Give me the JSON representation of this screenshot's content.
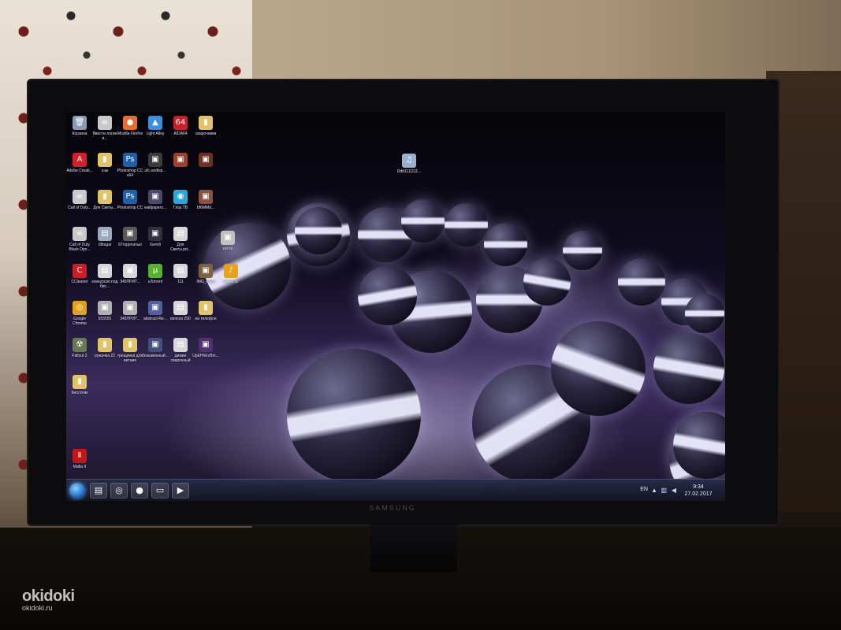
{
  "monitor": {
    "brand": "SAMSUNG"
  },
  "desktop": {
    "icons": [
      {
        "label": "Корзина",
        "icon": "recycle-bin-icon",
        "color": "#8a9bb8",
        "glyph": "🗑"
      },
      {
        "label": "Ввести логин и...",
        "icon": "skull-icon",
        "color": "#c9c9c9",
        "glyph": "☠"
      },
      {
        "label": "Mozilla Firefox",
        "icon": "firefox-icon",
        "color": "#e8702a",
        "glyph": "●"
      },
      {
        "label": "Light Alloy",
        "icon": "light-alloy-icon",
        "color": "#3b8fe0",
        "glyph": "▲"
      },
      {
        "label": "AIDA64",
        "icon": "aida64-icon",
        "color": "#c8202a",
        "glyph": "64"
      },
      {
        "label": "сварочники",
        "icon": "folder-icon",
        "color": "#e2c36a",
        "glyph": "▮"
      },
      {
        "label": "Adobe Creati...",
        "icon": "adobe-icon",
        "color": "#d4202a",
        "glyph": "A"
      },
      {
        "label": "ээы",
        "icon": "folder-icon",
        "color": "#e2c36a",
        "glyph": "▮"
      },
      {
        "label": "Photoshop CC x64",
        "icon": "photoshop-icon",
        "color": "#1f5fa8",
        "glyph": "Ps"
      },
      {
        "label": "ufc-undisp...",
        "icon": "image-file-icon",
        "color": "#3a3a3a",
        "glyph": "▣"
      },
      {
        "label": "",
        "icon": "photo-icon",
        "color": "#a0402a",
        "glyph": "▣"
      },
      {
        "label": "",
        "icon": "photo-icon",
        "color": "#703020",
        "glyph": "▣"
      },
      {
        "label": "Call of Duty...",
        "icon": "skull-icon",
        "color": "#c9c9c9",
        "glyph": "☠"
      },
      {
        "label": "Для Светы...",
        "icon": "folder-icon",
        "color": "#e2c36a",
        "glyph": "▮"
      },
      {
        "label": "Photoshop CC",
        "icon": "photoshop-icon",
        "color": "#1f5fa8",
        "glyph": "Ps"
      },
      {
        "label": "wallpapers...",
        "icon": "image-file-icon",
        "color": "#4a4a6a",
        "glyph": "▣"
      },
      {
        "label": "Глаз.ТВ",
        "icon": "tv-icon",
        "color": "#2aa8d8",
        "glyph": "◉"
      },
      {
        "label": "bf6MMd...",
        "icon": "photo-icon",
        "color": "#8a5040",
        "glyph": "▣"
      },
      {
        "label": "Call of Duty Black Ops...",
        "icon": "skull-icon",
        "color": "#c9c9c9",
        "glyph": "☠"
      },
      {
        "label": "dlbugai",
        "icon": "file-icon",
        "color": "#9aa8c0",
        "glyph": "▤"
      },
      {
        "label": "67roppnaтыо",
        "icon": "image-file-icon",
        "color": "#5a5a5a",
        "glyph": "▣"
      },
      {
        "label": "Хелоб",
        "icon": "image-file-icon",
        "color": "#303040",
        "glyph": "▣"
      },
      {
        "label": "Для Светы.pd...",
        "icon": "pdf-icon",
        "color": "#d6d6d6",
        "glyph": "▤"
      },
      {
        "label": "CCleaner",
        "icon": "ccleaner-icon",
        "color": "#c8202a",
        "glyph": "C"
      },
      {
        "label": "конкурсия под бис...",
        "icon": "file-icon",
        "color": "#d6d6d6",
        "glyph": "▤"
      },
      {
        "label": "345ПРИТ...",
        "icon": "image-file-icon",
        "color": "#d6d6d6",
        "glyph": "▣"
      },
      {
        "label": "uTorrent",
        "icon": "utorrent-icon",
        "color": "#58b030",
        "glyph": "µ"
      },
      {
        "label": "111",
        "icon": "file-icon",
        "color": "#d6d6d6",
        "glyph": "▤"
      },
      {
        "label": "IMG_0355",
        "icon": "photo-icon",
        "color": "#806040",
        "glyph": "▣"
      },
      {
        "label": "Audacity",
        "icon": "audacity-icon",
        "color": "#e8a020",
        "glyph": "♪"
      },
      {
        "label": "Google Chrome",
        "icon": "chrome-icon",
        "color": "#e0a020",
        "glyph": "◎"
      },
      {
        "label": "555555",
        "icon": "image-file-icon",
        "color": "#b0b0b0",
        "glyph": "▣"
      },
      {
        "label": "345ПРИТ...",
        "icon": "image-file-icon",
        "color": "#b0b0b0",
        "glyph": "▣"
      },
      {
        "label": "abstract-Re...",
        "icon": "image-file-icon",
        "color": "#5060a0",
        "glyph": "▣"
      },
      {
        "label": "вклсон 250",
        "icon": "file-icon",
        "color": "#d6d6d6",
        "glyph": "▤"
      },
      {
        "label": "на телефон",
        "icon": "folder-icon",
        "color": "#e2c36a",
        "glyph": "▮"
      },
      {
        "label": "Fallout 2",
        "icon": "game-icon",
        "color": "#6a7a50",
        "glyph": "☢"
      },
      {
        "label": "ружачка 22",
        "icon": "folder-icon",
        "color": "#e2c36a",
        "glyph": "▮"
      },
      {
        "label": "трещинки для витаия",
        "icon": "folder-icon",
        "color": "#e2c36a",
        "glyph": "▮"
      },
      {
        "label": "безымянный...",
        "icon": "image-file-icon",
        "color": "#405080",
        "glyph": "▣"
      },
      {
        "label": "димин сварочный",
        "icon": "file-icon",
        "color": "#d6d6d6",
        "glyph": "▤"
      },
      {
        "label": "UgEHhEvBm...",
        "icon": "photo-icon",
        "color": "#503070",
        "glyph": "▣"
      },
      {
        "label": "биологик",
        "icon": "folder-icon",
        "color": "#e2c36a",
        "glyph": "▮"
      },
      {
        "label": "Mafia II",
        "icon": "mafia-icon",
        "color": "#c01818",
        "glyph": "Ⅱ"
      },
      {
        "label": "Ddd1111111...",
        "icon": "audio-file-icon",
        "color": "#9ab0d0",
        "glyph": "♫"
      },
      {
        "label": "катор",
        "icon": "image-file-icon",
        "color": "#c0c0c0",
        "glyph": "▣"
      }
    ]
  },
  "taskbar": {
    "start_icon": "windows-start-icon",
    "pinned": [
      {
        "icon": "explorer-folder-icon",
        "glyph": "▤"
      },
      {
        "icon": "chrome-icon",
        "glyph": "◎"
      },
      {
        "icon": "firefox-icon",
        "glyph": "●"
      },
      {
        "icon": "desktop-icon",
        "glyph": "▭"
      },
      {
        "icon": "media-player-icon",
        "glyph": "▶"
      }
    ],
    "language": "EN",
    "time": "9:34",
    "date": "27.02.2017"
  },
  "watermark": {
    "brand": "okidoki",
    "domain": "okidoki.ru"
  }
}
